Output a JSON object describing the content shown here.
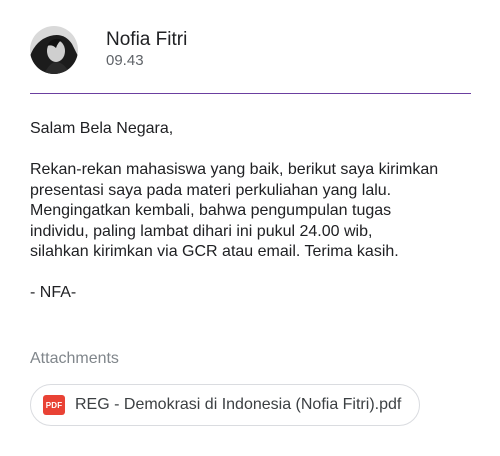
{
  "sender": {
    "name": "Nofia Fitri",
    "time": "09.43"
  },
  "divider_color": "#6b3fa0",
  "message": {
    "greeting": "Salam Bela Negara,",
    "body_lines": [
      "Rekan-rekan mahasiswa yang baik, berikut saya kirimkan",
      "presentasi saya pada materi perkuliahan yang lalu.",
      "Mengingatkan kembali, bahwa pengumpulan tugas",
      "individu, paling lambat dihari ini pukul 24.00 wib,",
      "silahkan kirimkan via GCR atau email. Terima kasih."
    ],
    "signoff": "- NFA-"
  },
  "attachments": {
    "label": "Attachments",
    "items": [
      {
        "icon": "pdf-icon",
        "icon_text": "PDF",
        "icon_color": "#e94235",
        "filename": "REG - Demokrasi di Indonesia (Nofia Fitri).pdf"
      }
    ]
  }
}
